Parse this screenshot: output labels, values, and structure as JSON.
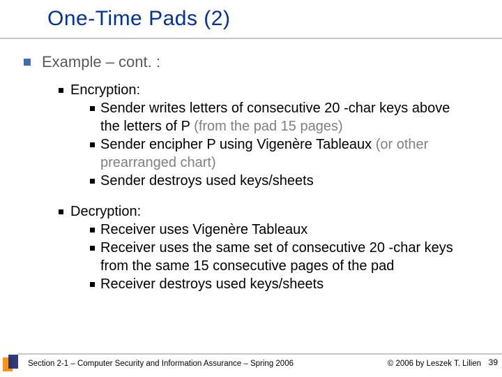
{
  "title": "One-Time Pads (2)",
  "heading": "Example – cont. :",
  "encryption": {
    "label": "Encryption:",
    "points": [
      {
        "main": "Sender writes letters of consecutive 20 -char keys above the letters of P ",
        "gray": "(from the pad 15 pages)"
      },
      {
        "main": "Sender encipher P using Vigenère Tableaux ",
        "gray": "(or other prearranged chart)"
      },
      {
        "main": "Sender destroys used keys/sheets",
        "gray": ""
      }
    ]
  },
  "decryption": {
    "label": "Decryption:",
    "points": [
      {
        "main": "Receiver uses Vigenère Tableaux",
        "gray": ""
      },
      {
        "main": "Receiver uses the same set of consecutive 20 -char keys from the same 15 consecutive pages of the pad",
        "gray": ""
      },
      {
        "main": "Receiver destroys used keys/sheets",
        "gray": ""
      }
    ]
  },
  "footer": {
    "left": "Section 2-1 – Computer Security and Information Assurance – Spring 2006",
    "right": "© 2006 by Leszek T. Lilien",
    "page": "39"
  }
}
